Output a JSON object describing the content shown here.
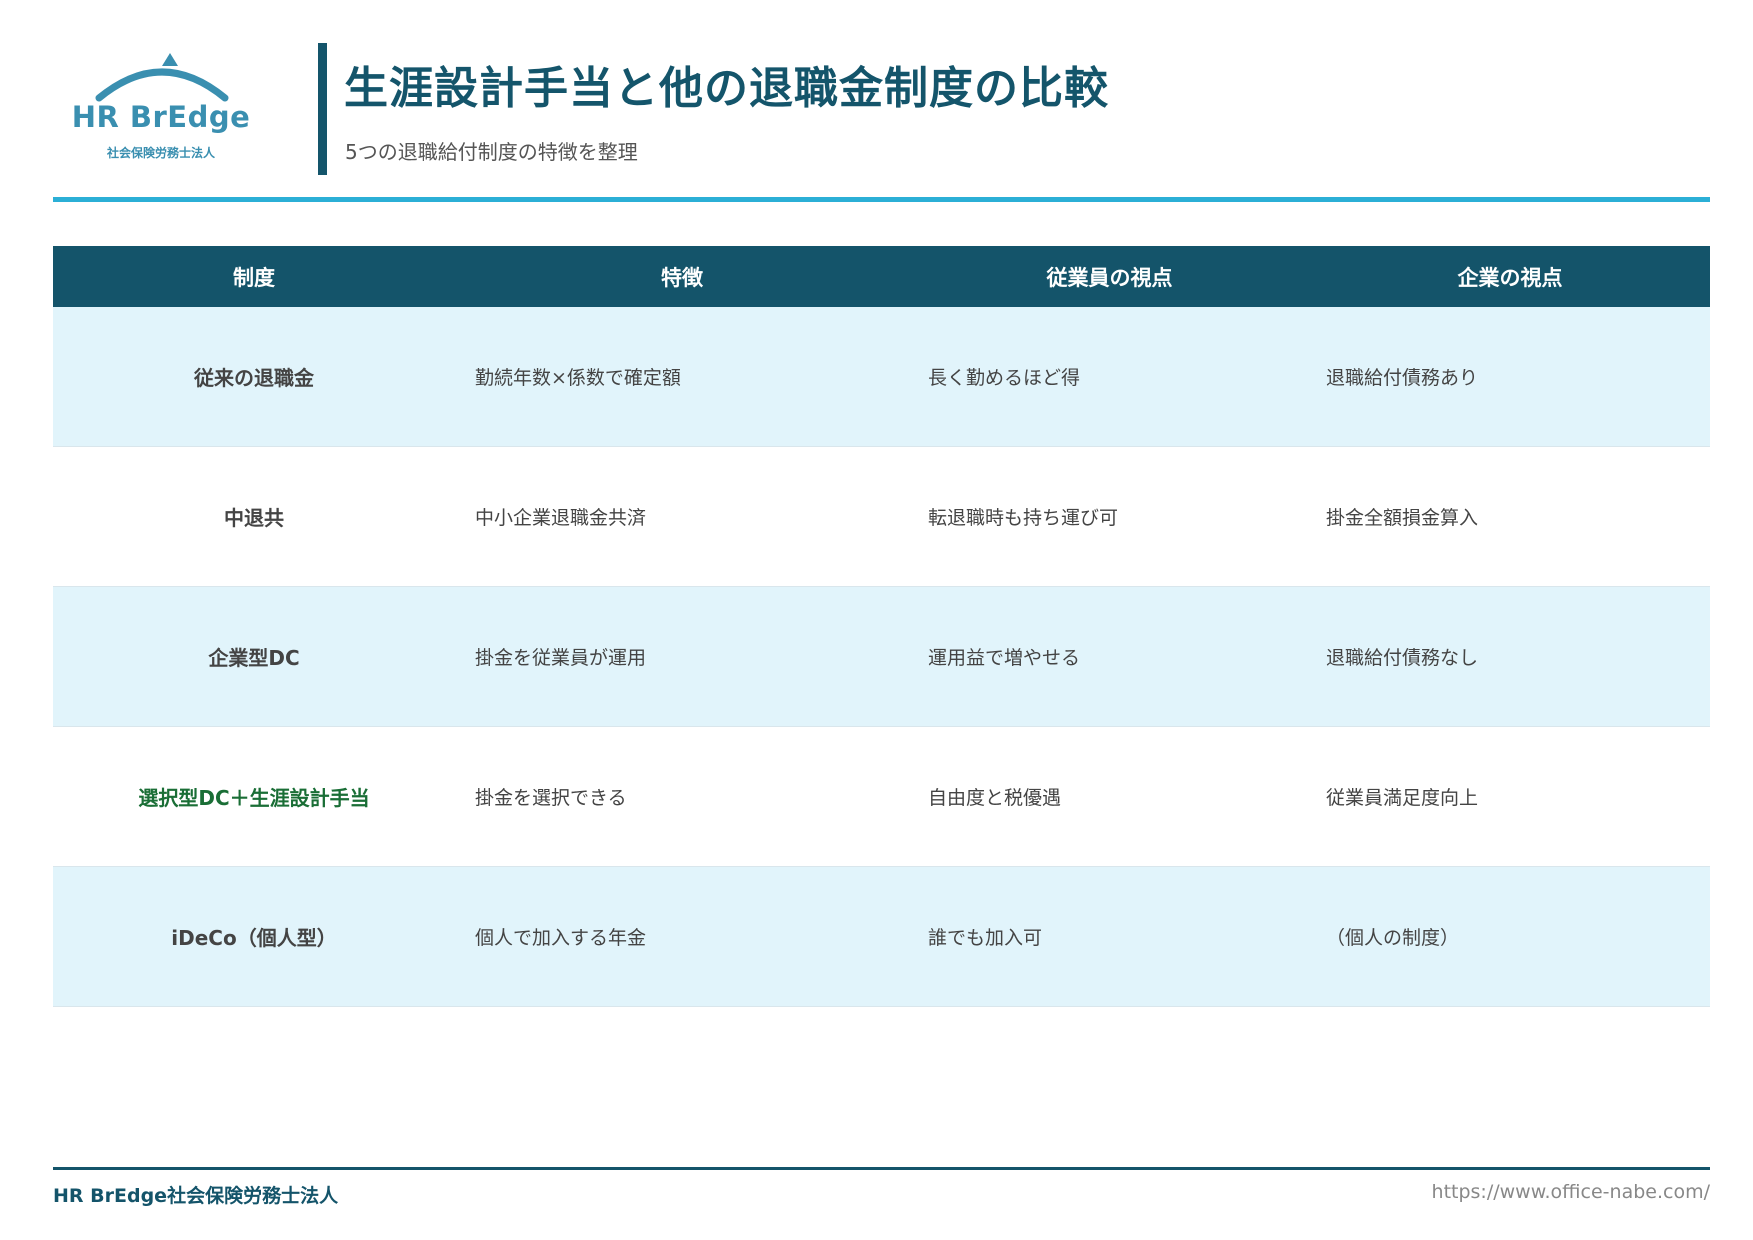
{
  "header": {
    "logo": {
      "name": "HR BrEdge",
      "subtitle": "社会保険労務士法人",
      "color": "#3a8fb0"
    },
    "title": "生涯設計手当と他の退職金制度の比較",
    "subtitle": "5つの退職給付制度の特徴を整理"
  },
  "table": {
    "headers": [
      "制度",
      "特徴",
      "従業員の視点",
      "企業の視点"
    ],
    "rows": [
      {
        "name": "従来の退職金",
        "feature": "勤続年数×係数で確定額",
        "employee": "長く勤めるほど得",
        "company": "退職給付債務あり",
        "highlight": false
      },
      {
        "name": "中退共",
        "feature": "中小企業退職金共済",
        "employee": "転退職時も持ち運び可",
        "company": "掛金全額損金算入",
        "highlight": false
      },
      {
        "name": "企業型DC",
        "feature": "掛金を従業員が運用",
        "employee": "運用益で増やせる",
        "company": "退職給付債務なし",
        "highlight": false
      },
      {
        "name": "選択型DC＋生涯設計手当",
        "feature": "掛金を選択できる",
        "employee": "自由度と税優遇",
        "company": "従業員満足度向上",
        "highlight": true
      },
      {
        "name": "iDeCo（個人型）",
        "feature": "個人で加入する年金",
        "employee": "誰でも加入可",
        "company": "（個人の制度）",
        "highlight": false
      }
    ]
  },
  "footer": {
    "company": "HR BrEdge社会保険労務士法人",
    "url": "https://www.office-nabe.com/"
  },
  "colors": {
    "primary": "#14546a",
    "accent": "#2bafd6",
    "row_shade": "#e1f4fb",
    "highlight_text": "#1a6e36"
  }
}
